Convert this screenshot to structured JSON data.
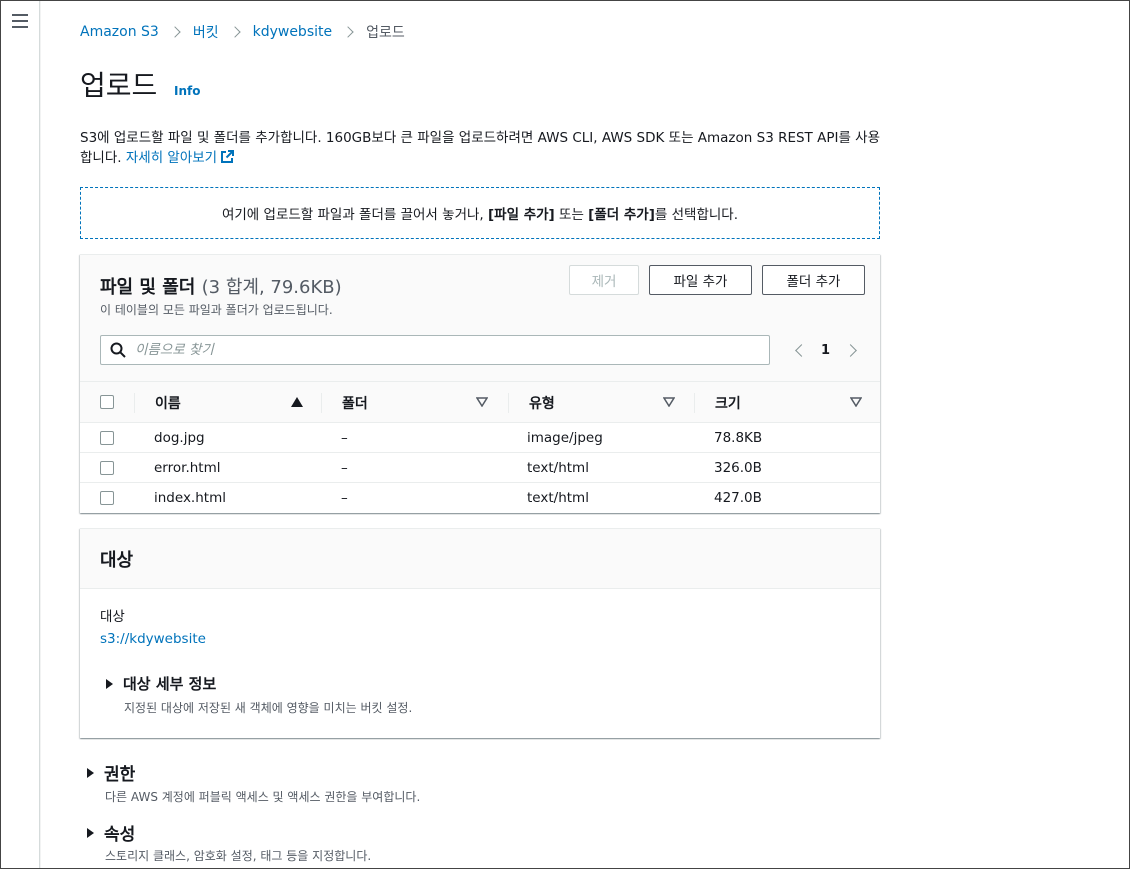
{
  "nav": {
    "menu_icon": "hamburger-menu-icon"
  },
  "breadcrumb": {
    "items": [
      {
        "label": "Amazon S3"
      },
      {
        "label": "버킷"
      },
      {
        "label": "kdywebsite"
      },
      {
        "label": "업로드"
      }
    ]
  },
  "page": {
    "title": "업로드",
    "info": "Info",
    "description": "S3에 업로드할 파일 및 폴더를 추가합니다. 160GB보다 큰 파일을 업로드하려면 AWS CLI, AWS SDK 또는 Amazon S3 REST API를 사용합니다.",
    "learn_more": "자세히 알아보기"
  },
  "dropzone": {
    "prefix": "여기에 업로드할 파일과 폴더를 끌어서 놓거나, ",
    "add_files": "[파일 추가]",
    "middle": " 또는 ",
    "add_folder": "[폴더 추가]",
    "suffix": "를 선택합니다."
  },
  "files": {
    "title": "파일 및 폴더",
    "count": "(3 합계, 79.6KB)",
    "subtitle": "이 테이블의 모든 파일과 폴더가 업로드됩니다.",
    "remove_label": "제거",
    "add_files_label": "파일 추가",
    "add_folder_label": "폴더 추가",
    "search_placeholder": "이름으로 찾기",
    "page": "1",
    "columns": [
      "이름",
      "폴더",
      "유형",
      "크기"
    ],
    "rows": [
      {
        "name": "dog.jpg",
        "folder": "–",
        "type": "image/jpeg",
        "size": "78.8KB"
      },
      {
        "name": "error.html",
        "folder": "–",
        "type": "text/html",
        "size": "326.0B"
      },
      {
        "name": "index.html",
        "folder": "–",
        "type": "text/html",
        "size": "427.0B"
      }
    ]
  },
  "destination": {
    "title": "대상",
    "label": "대상",
    "value": "s3://kdywebsite",
    "details_title": "대상 세부 정보",
    "details_desc": "지정된 대상에 저장된 새 객체에 영향을 미치는 버킷 설정."
  },
  "permissions": {
    "title": "권한",
    "desc": "다른 AWS 계정에 퍼블릭 액세스 및 액세스 권한을 부여합니다."
  },
  "properties": {
    "title": "속성",
    "desc": "스토리지 클래스, 암호화 설정, 태그 등을 지정합니다."
  },
  "colors": {
    "link": "#0073bb",
    "text": "#16191f",
    "muted": "#545b64"
  }
}
